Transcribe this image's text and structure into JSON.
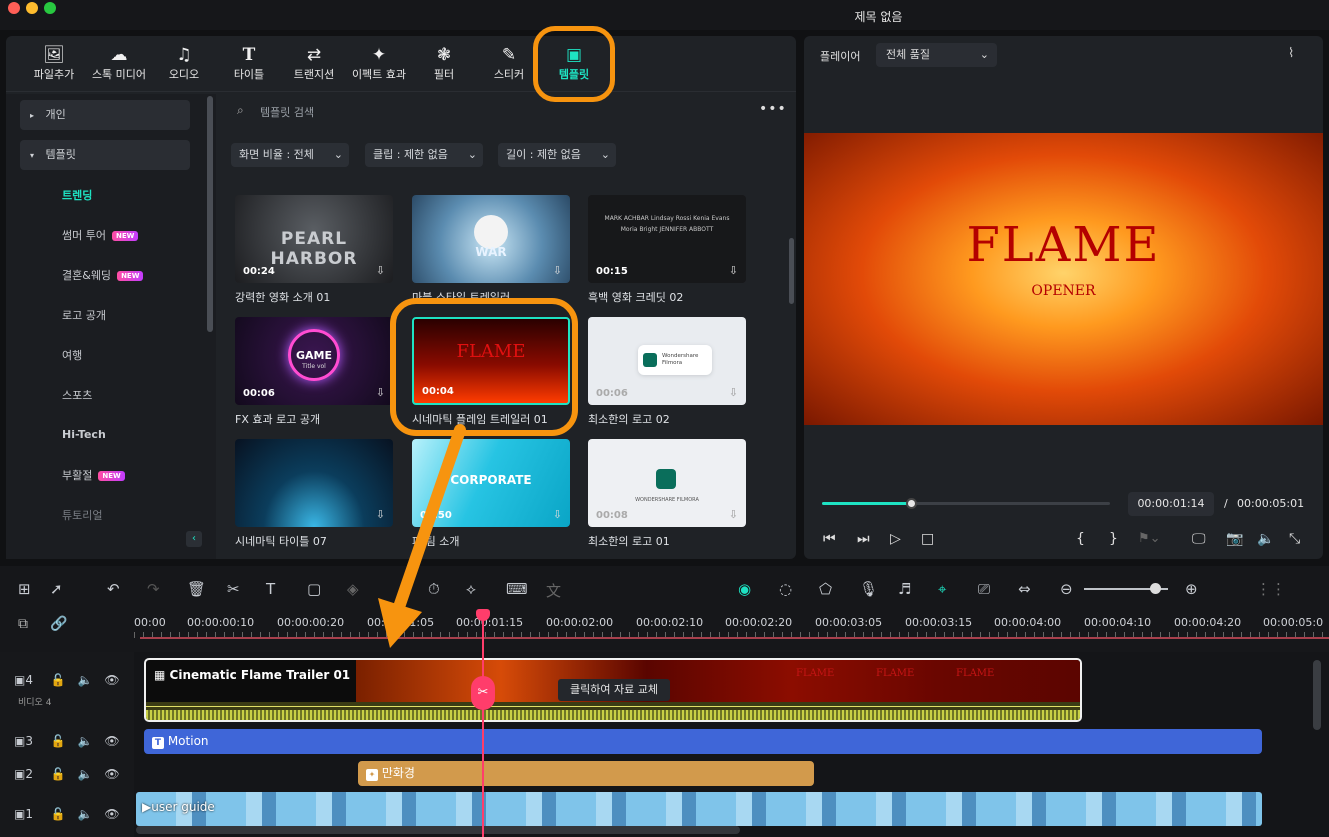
{
  "window": {
    "title": "제목 없음"
  },
  "toolbar": [
    {
      "label": "파일추가",
      "icon": "media-icon"
    },
    {
      "label": "스톡 미디어",
      "icon": "stock-icon"
    },
    {
      "label": "오디오",
      "icon": "music-icon"
    },
    {
      "label": "타이틀",
      "icon": "title-icon"
    },
    {
      "label": "트랜지션",
      "icon": "transition-icon"
    },
    {
      "label": "이펙트 효과",
      "icon": "effects-icon"
    },
    {
      "label": "필터",
      "icon": "filter-icon"
    },
    {
      "label": "스티커",
      "icon": "sticker-icon"
    },
    {
      "label": "템플릿",
      "icon": "template-icon",
      "active": true
    }
  ],
  "sidebar": {
    "personal": "개인",
    "templates": "템플릿",
    "categories": [
      {
        "label": "트렌딩",
        "active": true,
        "new": false
      },
      {
        "label": "썸머 투어",
        "new": true
      },
      {
        "label": "결혼&웨딩",
        "new": true
      },
      {
        "label": "로고 공개",
        "new": false
      },
      {
        "label": "여행",
        "new": false
      },
      {
        "label": "스포츠",
        "new": false
      },
      {
        "label": "Hi-Tech",
        "new": false
      },
      {
        "label": "부활절",
        "new": true
      },
      {
        "label": "튜토리얼",
        "new": false
      }
    ],
    "new_badge": "NEW"
  },
  "search": {
    "placeholder": "템플릿 검색"
  },
  "filters": {
    "ratio": "화면 비율 : 전체",
    "clip": "클립 : 제한 없음",
    "length": "길이 : 제한 없음"
  },
  "templates": [
    {
      "title": "강력한 영화 소개 01",
      "duration": "00:24",
      "overlay": "PEARL HARBOR"
    },
    {
      "title": "마블 스타일 트레일러",
      "duration": "",
      "overlay": "WAR"
    },
    {
      "title": "흑백 영화 크레딧 02",
      "duration": "00:15",
      "overlay": "MARK ACHBAR   Lindsay Rossi   Kenia Evans   Moria Bright   JENNIFER ABBOTT"
    },
    {
      "title": "FX 효과 로고 공개",
      "duration": "00:06",
      "overlay": "GAME",
      "overlay2": "Title vol"
    },
    {
      "title": "시네마틱 플레임 트레일러 01",
      "duration": "00:04",
      "overlay": "FLAME"
    },
    {
      "title": "최소한의 로고 02",
      "duration": "00:06",
      "overlay": "Wondershare Filmora"
    },
    {
      "title": "시네마틱 타이틀 07",
      "duration": "",
      "overlay": ""
    },
    {
      "title": "파 팀 소개",
      "duration": "00:50",
      "overlay": "CORPORATE"
    },
    {
      "title": "최소한의 로고 01",
      "duration": "00:08",
      "overlay": "WONDERSHARE FILMORA"
    }
  ],
  "player": {
    "label": "플레이어",
    "quality": "전체 품질",
    "video_title": "FLAME",
    "video_subtitle": "OPENER",
    "current_time": "00:00:01:14",
    "separator": "/",
    "total_time": "00:00:05:01",
    "progress": 0.31
  },
  "ruler": [
    "00:00",
    "00:00:00:10",
    "00:00:00:20",
    "00:00:01:05",
    "00:00:01:15",
    "00:00:02:00",
    "00:00:02:10",
    "00:00:02:20",
    "00:00:03:05",
    "00:00:03:15",
    "00:00:04:00",
    "00:00:04:10",
    "00:00:04:20",
    "00:00:05:0"
  ],
  "tracks": [
    {
      "num": "4",
      "name": "비디오 4"
    },
    {
      "num": "3",
      "name": ""
    },
    {
      "num": "2",
      "name": ""
    },
    {
      "num": "1",
      "name": ""
    }
  ],
  "clips": {
    "template_clip": "Cinematic Flame Trailer 01",
    "flame_text": "FLAME",
    "tooltip": "클릭하여 자료 교체",
    "motion": "Motion",
    "kaleido": "만화경",
    "user_guide": "user guide"
  },
  "colors": {
    "accent": "#1ee3c3",
    "highlight": "#f7940f",
    "motion": "#3f66d8",
    "kaleido": "#d29a4c",
    "playhead": "#ff3d6b"
  }
}
